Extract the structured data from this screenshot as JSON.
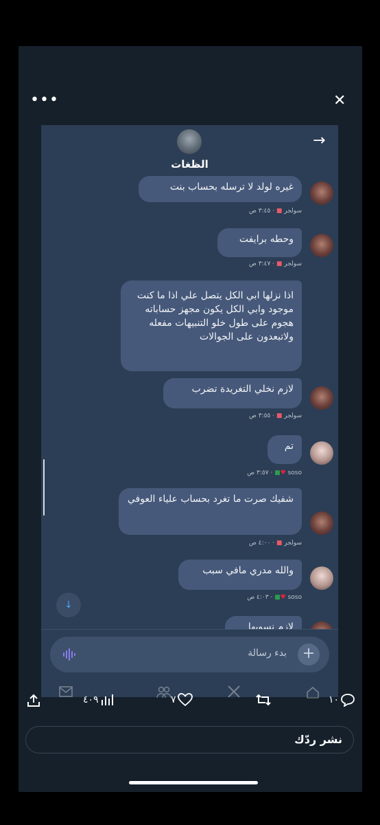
{
  "viewer": {
    "more_label": "•••",
    "close_label": "✕"
  },
  "chat": {
    "title": "الظغات",
    "back_arrow": "→",
    "messages": [
      {
        "text": "غيره لولد لا ترسله بحساب بنت",
        "sender": "سولجر",
        "time": "٣:٤٥ ص"
      },
      {
        "text": "وحطه برايفت",
        "sender": "سولجر",
        "time": "٣:٤٧ ص"
      },
      {
        "text": "اذا نزلها ابي الكل يتصل علي اذا ما كنت موجود وابي الكل يكون مجهز حساباته هجوم على طول خلو التنبيهات مفعله ولاتبعدون على الجوالات",
        "sender": "",
        "time": ""
      },
      {
        "text": "لازم نخلي التغريدة تضرب",
        "sender": "سولجر",
        "time": "٣:٥٥ ص"
      },
      {
        "text": "تم",
        "sender": "soso",
        "time": "٣:٥٧ ص"
      },
      {
        "text": "شفيك صرت ما تغرد بحساب علياء العوفي",
        "sender": "سولجر",
        "time": "٤:٠٠ ص"
      },
      {
        "text": "والله مدري مافي سبب",
        "sender": "soso",
        "time": "٤:٠٣ ص"
      },
      {
        "text": "لازم نسويها",
        "sender": "",
        "time": ""
      }
    ],
    "input_placeholder": "بدء رسالة",
    "plus_label": "+",
    "scroll_down_label": "↓"
  },
  "actions": {
    "replies": "١٠",
    "likes": "٧",
    "views": "٤٠٩"
  },
  "reply": {
    "placeholder": "نشر ردّك"
  },
  "colors": {
    "bubble": "#46597a",
    "chat_bg": "#2c3e55",
    "app_bg": "#15202b"
  }
}
